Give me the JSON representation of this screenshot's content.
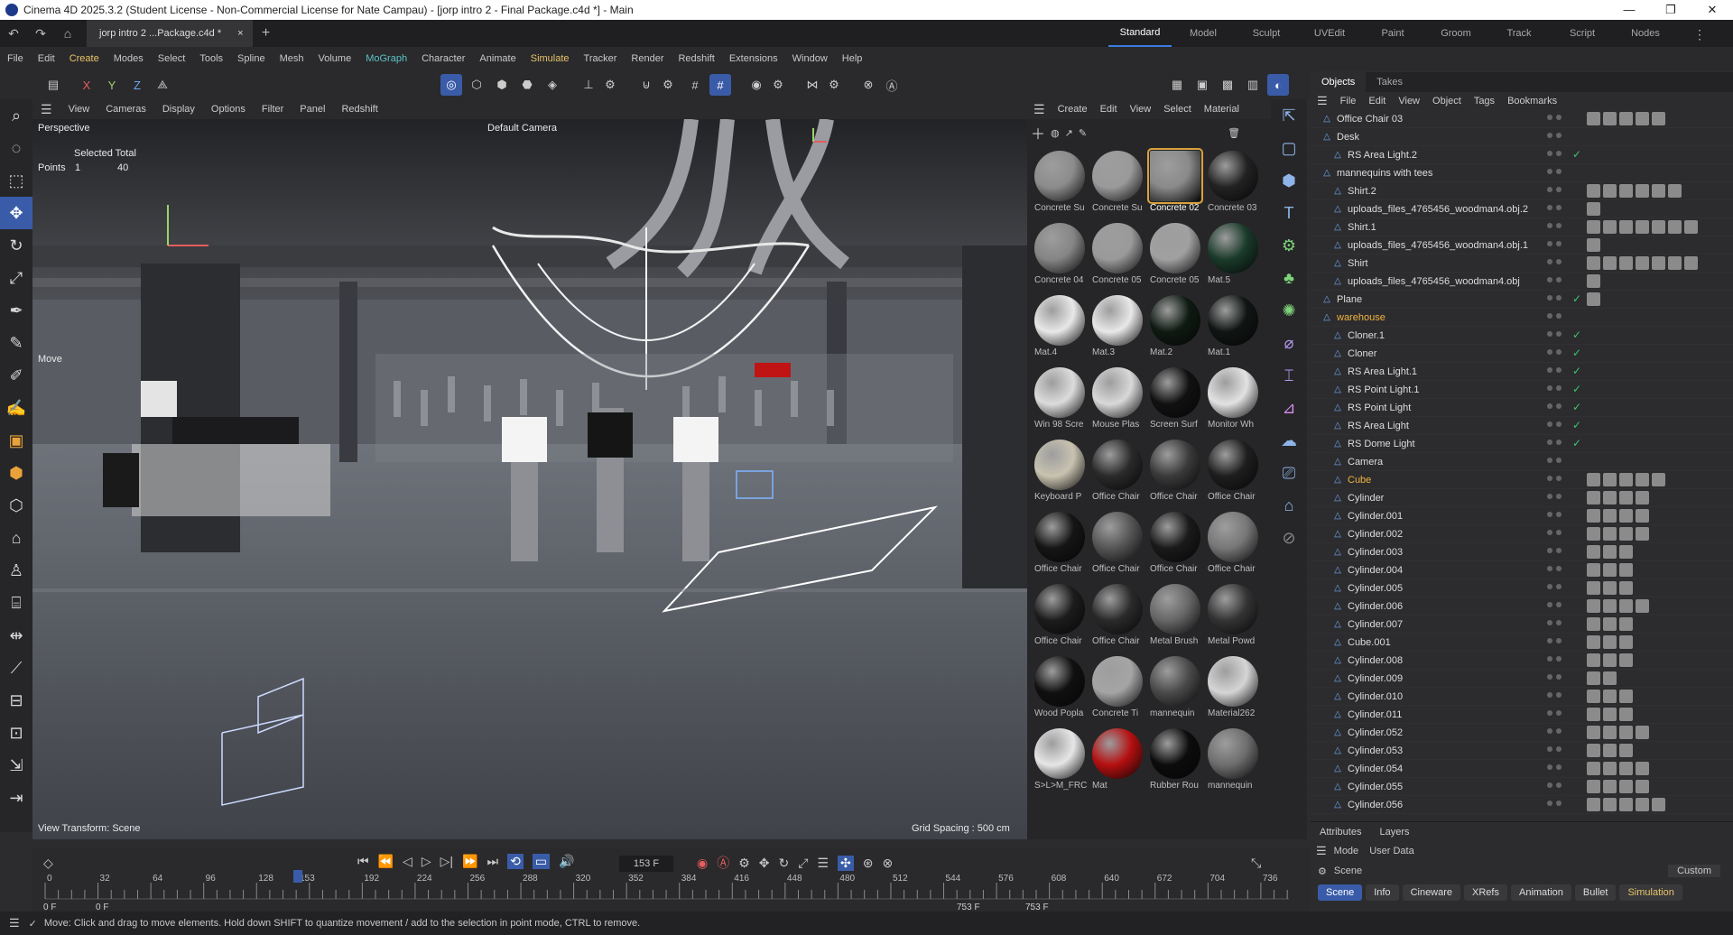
{
  "window": {
    "title": "Cinema 4D 2025.3.2 (Student License - Non-Commercial License for Nate Campau) - [jorp intro 2 - Final Package.c4d *] - Main",
    "min": "—",
    "max": "❐",
    "close": "✕"
  },
  "doc_tab": {
    "label": "jorp intro 2 ...Package.c4d *",
    "close": "×",
    "add": "+"
  },
  "layouts": [
    "Standard",
    "Model",
    "Sculpt",
    "UVEdit",
    "Paint",
    "Groom",
    "Track",
    "Script",
    "Nodes"
  ],
  "menu": [
    "File",
    "Edit",
    "Create",
    "Modes",
    "Select",
    "Tools",
    "Spline",
    "Mesh",
    "Volume",
    "MoGraph",
    "Character",
    "Animate",
    "Simulate",
    "Tracker",
    "Render",
    "Redshift",
    "Extensions",
    "Window",
    "Help"
  ],
  "axis": {
    "x": "X",
    "y": "Y",
    "z": "Z"
  },
  "viewport": {
    "menu": [
      "View",
      "Cameras",
      "Display",
      "Options",
      "Filter",
      "Panel",
      "Redshift"
    ],
    "name": "Perspective",
    "camera": "Default Camera",
    "sel_header": "Selected Total",
    "points_label": "Points",
    "points_sel": "1",
    "points_total": "40",
    "move_label": "Move",
    "view_transform": "View Transform: Scene",
    "grid_spacing": "Grid Spacing : 500 cm"
  },
  "materials": {
    "menu": [
      "Create",
      "Edit",
      "View",
      "Select",
      "Material"
    ],
    "items": [
      {
        "name": "Concrete Su",
        "color": "#8c8c8c"
      },
      {
        "name": "Concrete Su",
        "color": "#9a9a9a"
      },
      {
        "name": "Concrete 02",
        "color": "#8a8a8a"
      },
      {
        "name": "Concrete 03",
        "color": "#222222"
      },
      {
        "name": "Concrete 04",
        "color": "#858585"
      },
      {
        "name": "Concrete 05",
        "color": "#9a9a9a"
      },
      {
        "name": "Concrete 05",
        "color": "#a0a0a0"
      },
      {
        "name": "Mat.5",
        "color": "#1a3a2a"
      },
      {
        "name": "Mat.4",
        "color": "#e8e8e8"
      },
      {
        "name": "Mat.3",
        "color": "#e8e8e8"
      },
      {
        "name": "Mat.2",
        "color": "#0e1a12"
      },
      {
        "name": "Mat.1",
        "color": "#101513"
      },
      {
        "name": "Win 98 Scre",
        "color": "#dcdcdc"
      },
      {
        "name": "Mouse Plas",
        "color": "#d8d8d8"
      },
      {
        "name": "Screen Surf",
        "color": "#111111"
      },
      {
        "name": "Monitor Wh",
        "color": "#e2e2e2"
      },
      {
        "name": "Keyboard P",
        "color": "#c8c2b0"
      },
      {
        "name": "Office Chair",
        "color": "#2a2a2a"
      },
      {
        "name": "Office Chair",
        "color": "#3a3a3a"
      },
      {
        "name": "Office Chair",
        "color": "#1e1e1e"
      },
      {
        "name": "Office Chair",
        "color": "#151515"
      },
      {
        "name": "Office Chair",
        "color": "#555555"
      },
      {
        "name": "Office Chair",
        "color": "#1a1a1a"
      },
      {
        "name": "Office Chair",
        "color": "#777777"
      },
      {
        "name": "Office Chair",
        "color": "#1c1c1c"
      },
      {
        "name": "Office Chair",
        "color": "#2a2a2a"
      },
      {
        "name": "Metal Brush",
        "color": "#666666"
      },
      {
        "name": "Metal Powd",
        "color": "#333333"
      },
      {
        "name": "Wood Popla",
        "color": "#101010"
      },
      {
        "name": "Concrete Ti",
        "color": "#a5a5a5"
      },
      {
        "name": "mannequin",
        "color": "#4a4a4a"
      },
      {
        "name": "Material262",
        "color": "#d5d5d5"
      },
      {
        "name": "S>L>M_FRC",
        "color": "#e6e6e6"
      },
      {
        "name": "Mat",
        "color": "#b50f10"
      },
      {
        "name": "Rubber Rou",
        "color": "#0c0c0c"
      },
      {
        "name": "mannequin",
        "color": "#6e6e6e"
      }
    ]
  },
  "objects": {
    "tabs": [
      "Objects",
      "Takes"
    ],
    "menu": [
      "File",
      "Edit",
      "View",
      "Object",
      "Tags",
      "Bookmarks"
    ],
    "rows": [
      {
        "name": "Office Chair 03",
        "indent": 0,
        "check": false,
        "tags": 5,
        "orange": false
      },
      {
        "name": "Desk",
        "indent": 0,
        "check": false,
        "tags": 0,
        "orange": false
      },
      {
        "name": "RS Area Light.2",
        "indent": 1,
        "check": true,
        "tags": 0,
        "orange": false
      },
      {
        "name": "mannequins with tees",
        "indent": 0,
        "check": false,
        "tags": 0,
        "orange": false
      },
      {
        "name": "Shirt.2",
        "indent": 1,
        "check": false,
        "tags": 6,
        "orange": false
      },
      {
        "name": "uploads_files_4765456_woodman4.obj.2",
        "indent": 1,
        "check": false,
        "tags": 1,
        "orange": false
      },
      {
        "name": "Shirt.1",
        "indent": 1,
        "check": false,
        "tags": 7,
        "orange": false
      },
      {
        "name": "uploads_files_4765456_woodman4.obj.1",
        "indent": 1,
        "check": false,
        "tags": 1,
        "orange": false
      },
      {
        "name": "Shirt",
        "indent": 1,
        "check": false,
        "tags": 7,
        "orange": false
      },
      {
        "name": "uploads_files_4765456_woodman4.obj",
        "indent": 1,
        "check": false,
        "tags": 1,
        "orange": false
      },
      {
        "name": "Plane",
        "indent": 0,
        "check": true,
        "tags": 1,
        "orange": false
      },
      {
        "name": "warehouse",
        "indent": 0,
        "check": false,
        "tags": 0,
        "orange": true
      },
      {
        "name": "Cloner.1",
        "indent": 1,
        "check": true,
        "tags": 0,
        "orange": false
      },
      {
        "name": "Cloner",
        "indent": 1,
        "check": true,
        "tags": 0,
        "orange": false
      },
      {
        "name": "RS Area Light.1",
        "indent": 1,
        "check": true,
        "tags": 0,
        "orange": false
      },
      {
        "name": "RS Point Light.1",
        "indent": 1,
        "check": true,
        "tags": 0,
        "orange": false
      },
      {
        "name": "RS Point Light",
        "indent": 1,
        "check": true,
        "tags": 0,
        "orange": false
      },
      {
        "name": "RS Area Light",
        "indent": 1,
        "check": true,
        "tags": 0,
        "orange": false
      },
      {
        "name": "RS Dome Light",
        "indent": 1,
        "check": true,
        "tags": 0,
        "orange": false
      },
      {
        "name": "Camera",
        "indent": 1,
        "check": false,
        "tags": 0,
        "orange": false
      },
      {
        "name": "Cube",
        "indent": 1,
        "check": false,
        "tags": 5,
        "orange": true
      },
      {
        "name": "Cylinder",
        "indent": 1,
        "check": false,
        "tags": 4,
        "orange": false
      },
      {
        "name": "Cylinder.001",
        "indent": 1,
        "check": false,
        "tags": 4,
        "orange": false
      },
      {
        "name": "Cylinder.002",
        "indent": 1,
        "check": false,
        "tags": 4,
        "orange": false
      },
      {
        "name": "Cylinder.003",
        "indent": 1,
        "check": false,
        "tags": 3,
        "orange": false
      },
      {
        "name": "Cylinder.004",
        "indent": 1,
        "check": false,
        "tags": 3,
        "orange": false
      },
      {
        "name": "Cylinder.005",
        "indent": 1,
        "check": false,
        "tags": 3,
        "orange": false
      },
      {
        "name": "Cylinder.006",
        "indent": 1,
        "check": false,
        "tags": 4,
        "orange": false
      },
      {
        "name": "Cylinder.007",
        "indent": 1,
        "check": false,
        "tags": 3,
        "orange": false
      },
      {
        "name": "Cube.001",
        "indent": 1,
        "check": false,
        "tags": 3,
        "orange": false
      },
      {
        "name": "Cylinder.008",
        "indent": 1,
        "check": false,
        "tags": 3,
        "orange": false
      },
      {
        "name": "Cylinder.009",
        "indent": 1,
        "check": false,
        "tags": 2,
        "orange": false
      },
      {
        "name": "Cylinder.010",
        "indent": 1,
        "check": false,
        "tags": 3,
        "orange": false
      },
      {
        "name": "Cylinder.011",
        "indent": 1,
        "check": false,
        "tags": 3,
        "orange": false
      },
      {
        "name": "Cylinder.052",
        "indent": 1,
        "check": false,
        "tags": 4,
        "orange": false
      },
      {
        "name": "Cylinder.053",
        "indent": 1,
        "check": false,
        "tags": 3,
        "orange": false
      },
      {
        "name": "Cylinder.054",
        "indent": 1,
        "check": false,
        "tags": 4,
        "orange": false
      },
      {
        "name": "Cylinder.055",
        "indent": 1,
        "check": false,
        "tags": 4,
        "orange": false
      },
      {
        "name": "Cylinder.056",
        "indent": 1,
        "check": false,
        "tags": 5,
        "orange": false
      }
    ]
  },
  "attributes": {
    "tabs": [
      "Attributes",
      "Layers"
    ],
    "mode": "Mode",
    "user_data": "User Data",
    "scene": "Scene",
    "custom": "Custom",
    "buttons": [
      "Scene",
      "Info",
      "Cineware",
      "XRefs",
      "Animation",
      "Bullet",
      "Simulation"
    ]
  },
  "timeline": {
    "frame": "153 F",
    "ticks": [
      "0",
      "32",
      "64",
      "96",
      "128",
      "153",
      "192",
      "224",
      "256",
      "288",
      "320",
      "352",
      "384",
      "416",
      "448",
      "480",
      "512",
      "544",
      "576",
      "608",
      "640",
      "672",
      "704",
      "736"
    ],
    "current": 153,
    "max": 753,
    "start1": "0 F",
    "start2": "0 F",
    "end1": "753 F",
    "end2": "753 F"
  },
  "status": "Move: Click and drag to move elements. Hold down SHIFT to quantize movement / add to the selection in point mode, CTRL to remove."
}
